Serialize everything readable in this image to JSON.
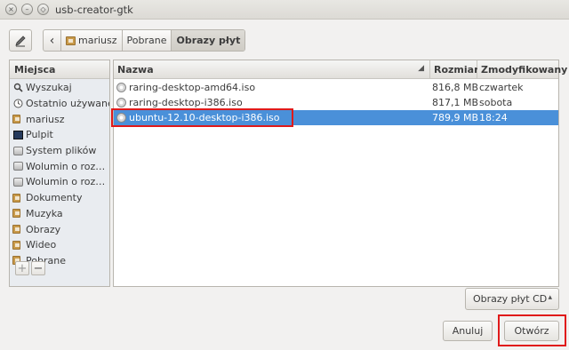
{
  "window": {
    "title": "usb-creator-gtk",
    "close_glyph": "×",
    "minimize_glyph": "–",
    "maximize_glyph": "◇"
  },
  "toolbar": {
    "edit_icon": "pencil-icon",
    "back_glyph": "‹"
  },
  "breadcrumb": [
    "mariusz",
    "Pobrane",
    "Obrazy płyt"
  ],
  "sidebar": {
    "header": "Miejsca",
    "items": [
      {
        "label": "Wyszukaj",
        "icon": "search-icon"
      },
      {
        "label": "Ostatnio używane",
        "icon": "clock-icon"
      },
      {
        "label": "mariusz",
        "icon": "home-folder-icon"
      },
      {
        "label": "Pulpit",
        "icon": "desktop-icon"
      },
      {
        "label": "System plików",
        "icon": "drive-icon"
      },
      {
        "label": "Wolumin o roz…",
        "icon": "drive-icon"
      },
      {
        "label": "Wolumin o roz…",
        "icon": "drive-icon"
      },
      {
        "label": "Dokumenty",
        "icon": "folder-icon"
      },
      {
        "label": "Muzyka",
        "icon": "folder-icon"
      },
      {
        "label": "Obrazy",
        "icon": "folder-icon"
      },
      {
        "label": "Wideo",
        "icon": "folder-icon"
      },
      {
        "label": "Pobrane",
        "icon": "folder-icon"
      }
    ],
    "add_glyph": "+",
    "remove_glyph": "−"
  },
  "file_list": {
    "columns": {
      "name": "Nazwa",
      "size": "Rozmiar",
      "modified": "Zmodyfikowany"
    },
    "sort_glyph": "◢",
    "rows": [
      {
        "name": "raring-desktop-amd64.iso",
        "size": "816,8 MB",
        "modified": "czwartek",
        "selected": false
      },
      {
        "name": "raring-desktop-i386.iso",
        "size": "817,1 MB",
        "modified": "sobota",
        "selected": false
      },
      {
        "name": "ubuntu-12.10-desktop-i386.iso",
        "size": "789,9 MB",
        "modified": "18:24",
        "selected": true
      }
    ]
  },
  "filter": {
    "label": "Obrazy płyt CD",
    "arrow_glyph": "▴"
  },
  "buttons": {
    "cancel": "Anuluj",
    "open": "Otwórz"
  },
  "colors": {
    "selection": "#4a90d9",
    "highlight": "#e01a1a"
  }
}
